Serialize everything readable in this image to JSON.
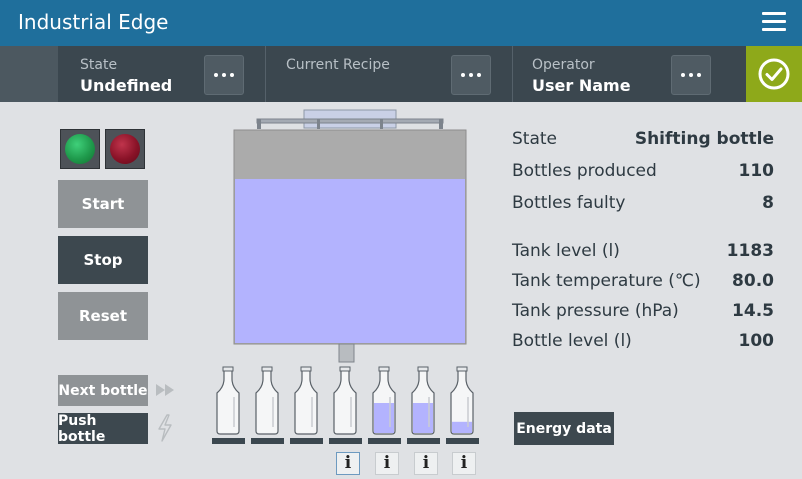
{
  "app": {
    "title": "Industrial Edge"
  },
  "statusbar": {
    "state": {
      "label": "State",
      "value": "Undefined"
    },
    "recipe": {
      "label": "Current Recipe",
      "value": ""
    },
    "operator": {
      "label": "Operator",
      "value": "User Name"
    },
    "status_icon": "check-circle-icon"
  },
  "controls": {
    "start": "Start",
    "stop": "Stop",
    "reset": "Reset",
    "next_bottle": "Next bottle",
    "push_bottle": "Push bottle",
    "energy": "Energy data"
  },
  "lamps": {
    "green": "#1f9a4c",
    "red": "#8a1328"
  },
  "tank": {
    "fill_fraction": 0.77,
    "liquid_color": "#b3b3fe"
  },
  "bottles": [
    {
      "fill": 0
    },
    {
      "fill": 0
    },
    {
      "fill": 0
    },
    {
      "fill": 0
    },
    {
      "fill": 0.75
    },
    {
      "fill": 0.75
    },
    {
      "fill": 0.28
    }
  ],
  "info_buttons": [
    "i",
    "i",
    "i",
    "i"
  ],
  "info": {
    "rows": [
      {
        "label": "State",
        "value": "Shifting bottle"
      },
      {
        "label": "Bottles produced",
        "value": "110"
      },
      {
        "label": "Bottles faulty",
        "value": "8"
      },
      {
        "label": "Tank level (l)",
        "value": "1183"
      },
      {
        "label": "Tank temperature (℃)",
        "value": "80.0"
      },
      {
        "label": "Tank pressure (hPa)",
        "value": "14.5"
      },
      {
        "label": "Bottle level (l)",
        "value": "100"
      }
    ]
  },
  "colors": {
    "header": "#1f6f9c",
    "statusbar": "#3b474f",
    "ok": "#8ea91a",
    "accent_dark": "#3d484f"
  }
}
